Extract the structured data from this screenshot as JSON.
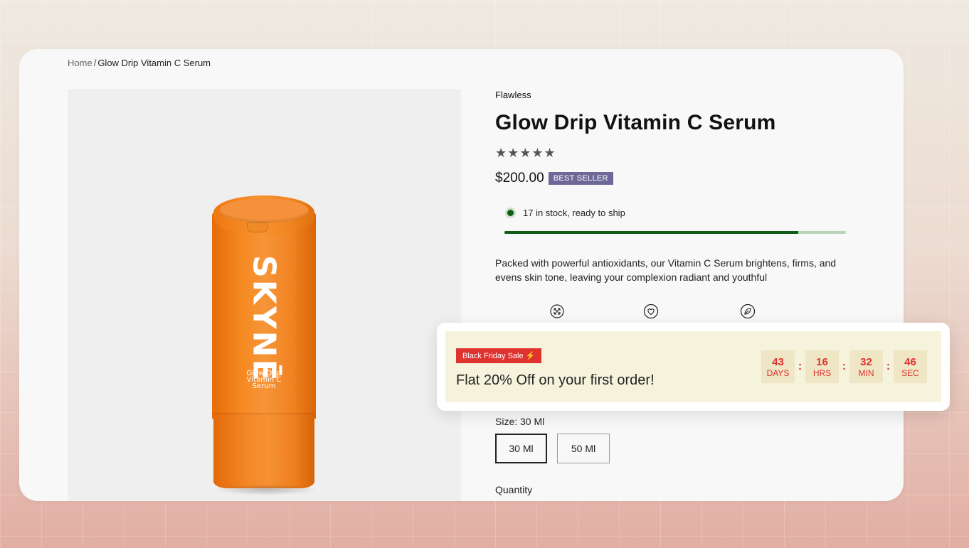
{
  "breadcrumb": {
    "home": "Home",
    "separator": "/",
    "current": "Glow Drip Vitamin C Serum"
  },
  "product": {
    "image": {
      "brand": "SKYNĒ",
      "subtitle_lines": [
        "Glow Drip",
        "Vitamin C",
        "Serum"
      ],
      "bottle_color": "#f28a24"
    },
    "vendor": "Flawless",
    "title": "Glow Drip Vitamin C Serum",
    "rating_stars": "★★★★★",
    "price": "$200.00",
    "badge": "BEST SELLER",
    "stock": {
      "text": "17 in stock, ready to ship",
      "level_percent": 86
    },
    "description": "Packed with powerful antioxidants, our Vitamin C Serum brightens, firms, and evens skin tone, leaving your complexion radiant and youthful",
    "feature_icons": [
      "expand-arrows-icon",
      "heart-icon",
      "leaf-icon"
    ],
    "size": {
      "label": "Size: 30 Ml",
      "options": [
        "30 Ml",
        "50 Ml"
      ],
      "selected": "30 Ml"
    },
    "quantity_label": "Quantity"
  },
  "promo": {
    "tag": "Black Friday Sale ⚡",
    "text": "Flat 20% Off on your first order!",
    "timer": [
      {
        "value": "43",
        "label": "DAYS"
      },
      {
        "value": "16",
        "label": "HRS"
      },
      {
        "value": "32",
        "label": "MIN"
      },
      {
        "value": "46",
        "label": "SEC"
      }
    ],
    "separator": ":"
  },
  "colors": {
    "badge": "#6e6898",
    "stock_green": "#0f5c17",
    "sale_red": "#e0322f",
    "promo_bg": "#f6f3dd"
  }
}
